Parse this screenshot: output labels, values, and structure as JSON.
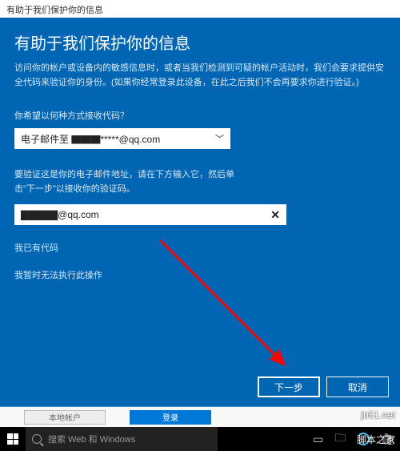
{
  "titlebar": {
    "text": "有助于我们保护你的信息"
  },
  "header": {
    "heading": "有助于我们保护你的信息",
    "description": "访问你的帐户或设备内的敏感信息时，或者当我们检测到可疑的帐户活动时，我们会要求提供安全代码来验证你的身份。(如果你经常登录此设备，在此之后我们不会再要求你进行验证。)"
  },
  "method": {
    "prompt": "你希望以何种方式接收代码？",
    "selected": "电子邮件至 ▇▇▇*****@qq.com"
  },
  "verify": {
    "instruction": "要验证这是你的电子邮件地址，请在下方输入它，然后单击\"下一步\"以接收你的验证码。",
    "input_value": "▇▇▇▇▇@qq.com"
  },
  "links": {
    "have_code": "我已有代码",
    "cannot_do": "我暂时无法执行此操作"
  },
  "buttons": {
    "next": "下一步",
    "cancel": "取消"
  },
  "legacy_buttons": {
    "local": "本地帐户",
    "login": "登录"
  },
  "taskbar": {
    "search_placeholder": "搜索 Web 和 Windows"
  },
  "watermark": {
    "top": "jb51.net",
    "bottom": "脚本之家"
  }
}
